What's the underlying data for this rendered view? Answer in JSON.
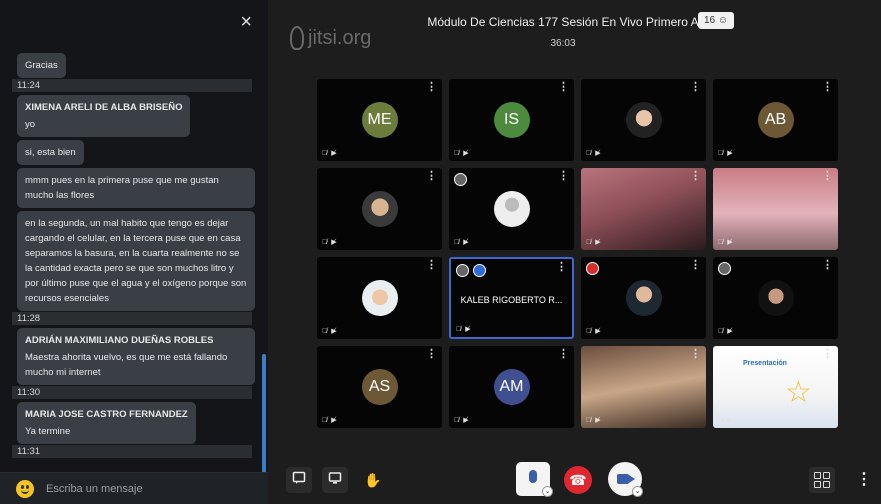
{
  "chat": {
    "close_label": "×",
    "input_placeholder": "Escriba un mensaje",
    "messages": [
      {
        "text": "Gracias"
      },
      {
        "time": "11:24"
      },
      {
        "sender": "XIMENA ARELI DE ALBA BRISEÑO",
        "text": "yo"
      },
      {
        "text": "si, esta bien"
      },
      {
        "text": "mmm pues en la primera puse que me gustan mucho las flores"
      },
      {
        "text": "en la segunda, un mal habito que tengo es dejar cargando el celular, en la tercera puse que en casa separamos la basura, en la cuarta realmente no se la cantidad exacta pero se que son muchos litro y por último puse que el agua y el oxígeno porque son recursos esenciales"
      },
      {
        "time": "11:28"
      },
      {
        "sender": "ADRIÁN MAXIMILIANO DUEÑAS ROBLES",
        "text": "Maestra ahorita vuelvo, es que me está fallando mucho mi internet"
      },
      {
        "time": "11:30"
      },
      {
        "sender": "MARIA JOSE CASTRO FERNANDEZ",
        "text": "Ya termine"
      },
      {
        "time": "11:31"
      }
    ]
  },
  "header": {
    "logo": "jitsi.org",
    "title": "Módulo De Ciencias 177 Sesión En Vivo Primero A",
    "timer": "36:03",
    "participant_count": "16"
  },
  "tiles": [
    {
      "type": "initials",
      "initials": "ME",
      "color": "#6b7c3b"
    },
    {
      "type": "initials",
      "initials": "IS",
      "color": "#4c8a3e"
    },
    {
      "type": "photo",
      "style": "face1"
    },
    {
      "type": "initials",
      "initials": "AB",
      "color": "#6d5836"
    },
    {
      "type": "photo",
      "style": "face2"
    },
    {
      "type": "photo",
      "style": "blank",
      "signal": "grey"
    },
    {
      "type": "video",
      "bg": "linear-gradient(160deg,#b9747e 0%,#8d4f57 45%,#2d1b1e 100%)"
    },
    {
      "type": "video",
      "bg": "linear-gradient(180deg,#c97d85 0%,#e3b3ba 55%,#8b6a6e 100%)"
    },
    {
      "type": "photo",
      "style": "face3"
    },
    {
      "type": "named",
      "name": "KALEB RIGOBERTO R...",
      "active": true,
      "signal": "grey",
      "signal2": "blue"
    },
    {
      "type": "photo",
      "style": "face4",
      "signal": "red"
    },
    {
      "type": "photo",
      "style": "face5",
      "signal": "grey"
    },
    {
      "type": "initials",
      "initials": "AS",
      "color": "#6d5836"
    },
    {
      "type": "initials",
      "initials": "AM",
      "color": "#3f4f8f"
    },
    {
      "type": "video",
      "bg": "linear-gradient(170deg,#6b4e3e 0%,#c9a688 50%,#3b2b22 100%)"
    },
    {
      "type": "video",
      "bg": "linear-gradient(180deg,#ffffff 0%,#f4f4f4 60%,#d8e3f0 100%)",
      "slide": "Presentación"
    }
  ],
  "toolbar": {
    "chat_icon": "chat-icon",
    "screen_icon": "screen-share-icon",
    "hand_icon": "raise-hand-icon",
    "hangup_glyph": "☎",
    "more_glyph": "⋮",
    "hand_glyph": "✋"
  }
}
